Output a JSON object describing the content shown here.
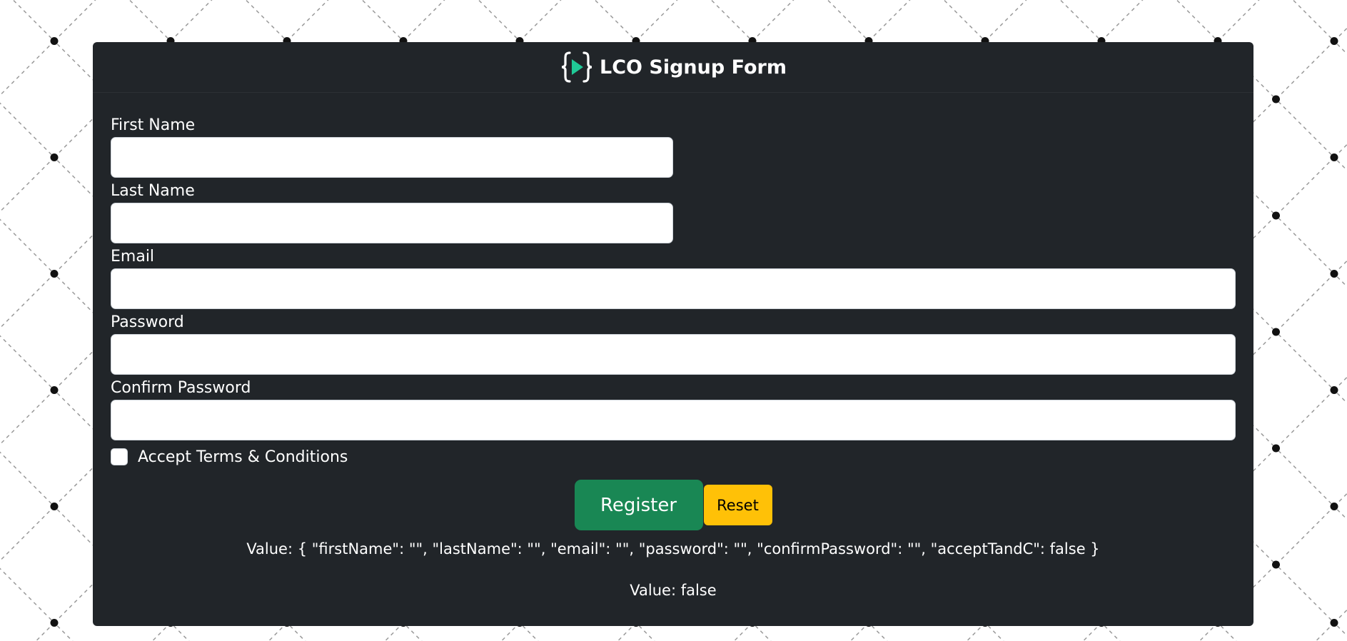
{
  "header": {
    "title": "LCO Signup Form",
    "logo_icon": "code-play-icon",
    "logo_color": "#20c997"
  },
  "form": {
    "first_name_label": "First Name",
    "first_name_value": "",
    "last_name_label": "Last Name",
    "last_name_value": "",
    "email_label": "Email",
    "email_value": "",
    "password_label": "Password",
    "password_value": "",
    "confirm_password_label": "Confirm Password",
    "confirm_password_value": "",
    "accept_label": "Accept Terms & Conditions",
    "accept_checked": false
  },
  "buttons": {
    "register_label": "Register",
    "reset_label": "Reset"
  },
  "output": {
    "value_json": "Value: { \"firstName\": \"\", \"lastName\": \"\", \"email\": \"\", \"password\": \"\", \"confirmPassword\": \"\", \"acceptTandC\": false }",
    "value_bool": "Value: false"
  },
  "colors": {
    "card_bg": "#212529",
    "register_bg": "#198754",
    "reset_bg": "#ffc107"
  }
}
